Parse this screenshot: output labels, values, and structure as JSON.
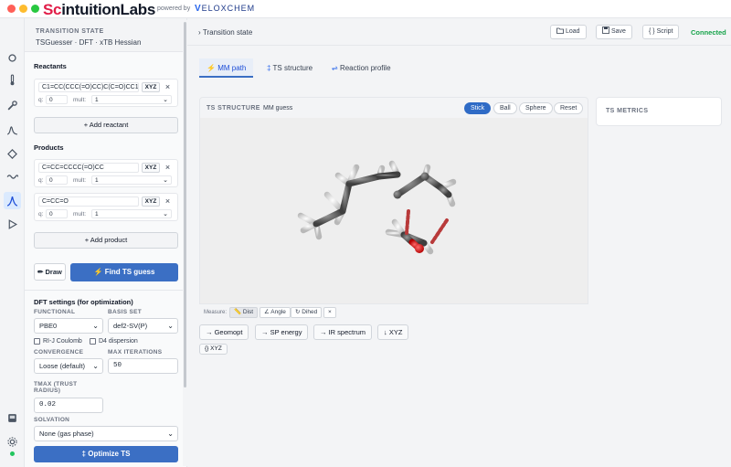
{
  "app": {
    "brand_prefix": "Sc",
    "brand_rest": "intuitionLabs",
    "powered_by": "powered by",
    "partner_mark": "V",
    "partner_rest": "ELOXCHEM"
  },
  "panel": {
    "title": "TRANSITION STATE",
    "subtitle": "TSGuesser · DFT · xTB Hessian",
    "reactants_label": "Reactants",
    "reactants": [
      {
        "smiles": "C1=CC(CCC(=O)CC)C(C=O)CC1",
        "xyz": "XYZ",
        "remove": "×",
        "q_label": "q:",
        "q": "0",
        "mult_label": "mult:",
        "mult": "1"
      }
    ],
    "add_reactant": "+ Add reactant",
    "products_label": "Products",
    "products": [
      {
        "smiles": "C=CC=CCCC(=O)CC",
        "xyz": "XYZ",
        "remove": "×",
        "q_label": "q:",
        "q": "0",
        "mult_label": "mult:",
        "mult": "1"
      },
      {
        "smiles": "C=CC=O",
        "xyz": "XYZ",
        "remove": "×",
        "q_label": "q:",
        "q": "0",
        "mult_label": "mult:",
        "mult": "1"
      }
    ],
    "add_product": "+ Add product",
    "draw": "✏ Draw",
    "find_ts": "⚡ Find TS guess",
    "dft_title": "DFT settings (for optimization)",
    "functional_label": "FUNCTIONAL",
    "functional": "PBE0",
    "basis_label": "BASIS SET",
    "basis": "def2-SV(P)",
    "rij_label": "RI-J Coulomb",
    "d4_label": "D4 dispersion",
    "convergence_label": "CONVERGENCE",
    "convergence": "Loose (default)",
    "maxiter_label": "MAX ITERATIONS",
    "maxiter": "50",
    "tmax_label_1": "TMAX (TRUST",
    "tmax_label_2": "RADIUS)",
    "tmax": "0.02",
    "solvation_label": "SOLVATION",
    "solvation": "None (gas phase)",
    "optimize": "‡ Optimize TS"
  },
  "topbar": {
    "breadcrumb_sep": "›",
    "breadcrumb": "Transition state",
    "load": "Load",
    "save": "Save",
    "script": "{ } Script",
    "status": "Connected"
  },
  "tabs": [
    {
      "icon": "⚡",
      "label": "MM path"
    },
    {
      "icon": "‡",
      "label": "TS structure"
    },
    {
      "icon": "⇌",
      "label": "Reaction profile"
    }
  ],
  "viewer": {
    "title": "TS STRUCTURE",
    "subtitle": "MM guess",
    "styles": [
      "Stick",
      "Ball",
      "Sphere",
      "Reset"
    ],
    "measure_label": "Measure:",
    "measure": [
      "Dist",
      "Angle",
      "Dihed"
    ],
    "measure_clear": "×"
  },
  "actions": [
    "→ Geomopt",
    "→ SP energy",
    "→ IR spectrum",
    "↓ XYZ"
  ],
  "action_small": "{} XYZ",
  "metrics_title": "TS METRICS",
  "colors": {
    "accent": "#3b6fc4",
    "connected": "#16a34a",
    "carbon": "#5a5a5a",
    "hydrogen": "#e8e8e8",
    "oxygen": "#e11d1d",
    "forming_bond": "#b83a3a"
  }
}
